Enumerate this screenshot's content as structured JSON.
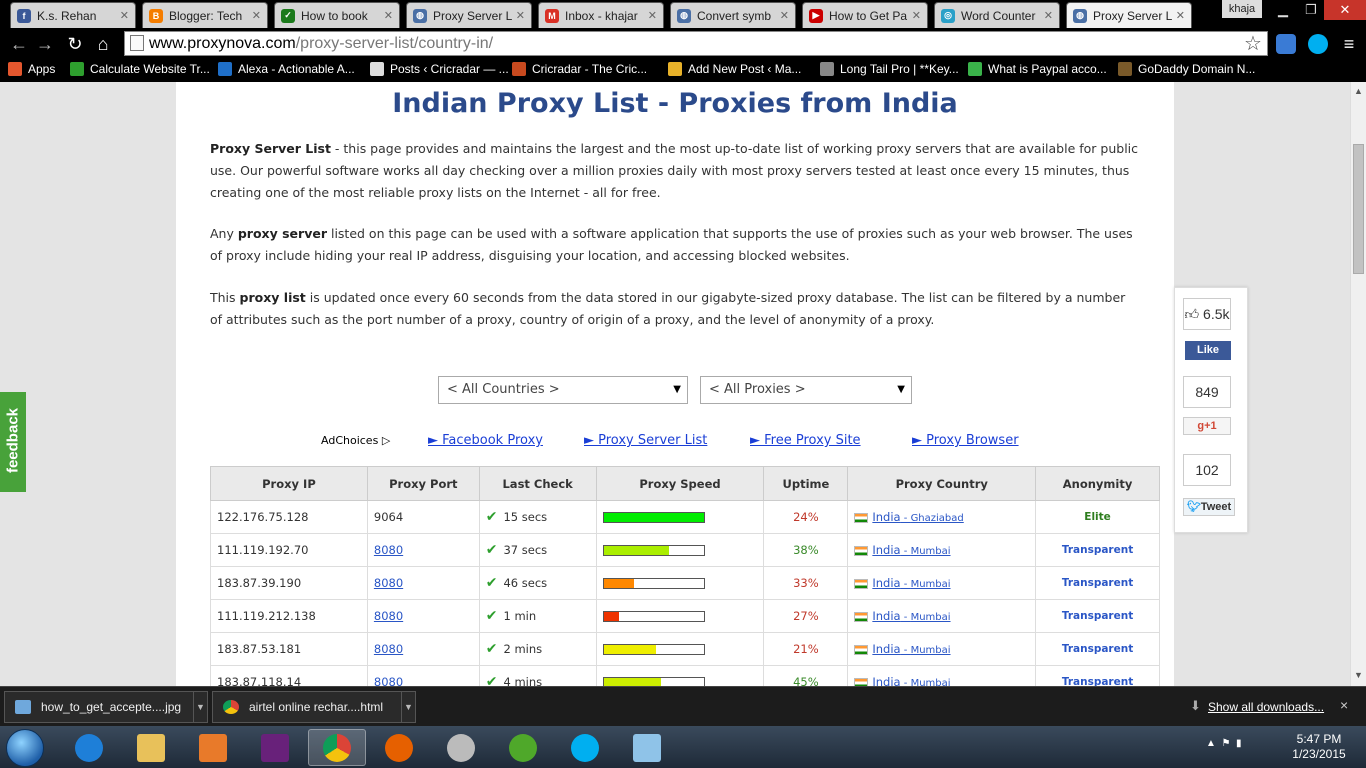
{
  "browser": {
    "tabs": [
      {
        "title": "K.s. Rehan",
        "icon": "facebook-icon",
        "color": "#3b5998",
        "glyph": "f"
      },
      {
        "title": "Blogger: Tech",
        "icon": "blogger-icon",
        "color": "#f57d00",
        "glyph": "B"
      },
      {
        "title": "How to book",
        "icon": "checkmark-favicon",
        "color": "#1b7a1b",
        "glyph": "✓"
      },
      {
        "title": "Proxy Server L",
        "icon": "globe-icon",
        "color": "#4a6fa5",
        "glyph": "◍"
      },
      {
        "title": "Inbox - khajar",
        "icon": "gmail-icon",
        "color": "#d93025",
        "glyph": "M"
      },
      {
        "title": "Convert symb",
        "icon": "globe-icon",
        "color": "#4a6fa5",
        "glyph": "◍"
      },
      {
        "title": "How to Get Pa",
        "icon": "youtube-icon",
        "color": "#cc0000",
        "glyph": "▶"
      },
      {
        "title": "Word Counter",
        "icon": "wordcounter-icon",
        "color": "#2aa0c8",
        "glyph": "◎"
      },
      {
        "title": "Proxy Server L",
        "icon": "globe-icon",
        "color": "#4a6fa5",
        "glyph": "◍"
      }
    ],
    "user_badge": "khaja",
    "address": {
      "host": "www.proxynova.com",
      "path": "/proxy-server-list/country-in/"
    },
    "bookmarks": [
      {
        "label": "Apps",
        "icon": "apps-grid-icon",
        "color": "#e4572e"
      },
      {
        "label": "Calculate Website Tr...",
        "icon": "dollar-icon",
        "color": "#2e9f2e"
      },
      {
        "label": "Alexa - Actionable A...",
        "icon": "alexa-icon",
        "color": "#1f6fc8"
      },
      {
        "label": "Posts ‹ Cricradar — ...",
        "icon": "document-icon",
        "color": "#dddddd"
      },
      {
        "label": "Cricradar - The Cric...",
        "icon": "cricradar-icon",
        "color": "#c84a1f"
      },
      {
        "label": "Add New Post ‹ Ma...",
        "icon": "people-icon",
        "color": "#e8b22a"
      },
      {
        "label": "Long Tail Pro | **Key...",
        "icon": "g-icon",
        "color": "#888888"
      },
      {
        "label": "What is Paypal acco...",
        "icon": "star-icon",
        "color": "#3ab34a"
      },
      {
        "label": "GoDaddy Domain N...",
        "icon": "godaddy-icon",
        "color": "#7a5a2a"
      }
    ]
  },
  "page": {
    "title": "Indian Proxy List - Proxies from India",
    "paragraphs": {
      "p1_bold": "Proxy Server List",
      "p1_rest": " - this page provides and maintains the largest and the most up-to-date list of working proxy servers that are available for public use. Our powerful software works all day checking over a million proxies daily with most proxy servers tested at least once every 15 minutes, thus creating one of the most reliable proxy lists on the Internet - all for free.",
      "p2_a": "Any ",
      "p2_bold": "proxy server",
      "p2_rest": " listed on this page can be used with a software application that supports the use of proxies such as your web browser. The uses of proxy include hiding your real IP address, disguising your location, and accessing blocked websites.",
      "p3_a": "This ",
      "p3_bold": "proxy list",
      "p3_rest": " is updated once every 60 seconds from the data stored in our gigabyte-sized proxy database. The list can be filtered by a number of attributes such as the port number of a proxy, country of origin of a proxy, and the level of anonymity of a proxy."
    },
    "filters": {
      "countries": "< All Countries >",
      "proxies": "< All Proxies >"
    },
    "adchoices": "AdChoices",
    "ad_links": [
      "► Facebook Proxy",
      "► Proxy Server List",
      "► Free Proxy Site",
      "► Proxy Browser"
    ],
    "table": {
      "headers": [
        "Proxy IP",
        "Proxy Port",
        "Last Check",
        "Proxy Speed",
        "Uptime",
        "Proxy Country",
        "Anonymity"
      ],
      "rows": [
        {
          "ip": "122.176.75.128",
          "port": "9064",
          "port_link": false,
          "check": "15 secs",
          "speed": 1.0,
          "speed_color": "#00ee00",
          "uptime": "24%",
          "country": "India",
          "city": "Ghaziabad",
          "anonymity": "Elite"
        },
        {
          "ip": "111.119.192.70",
          "port": "8080",
          "port_link": true,
          "check": "37 secs",
          "speed": 0.65,
          "speed_color": "#aaee00",
          "uptime": "38%",
          "country": "India",
          "city": "Mumbai",
          "anonymity": "Transparent"
        },
        {
          "ip": "183.87.39.190",
          "port": "8080",
          "port_link": true,
          "check": "46 secs",
          "speed": 0.3,
          "speed_color": "#ff8800",
          "uptime": "33%",
          "country": "India",
          "city": "Mumbai",
          "anonymity": "Transparent"
        },
        {
          "ip": "111.119.212.138",
          "port": "8080",
          "port_link": true,
          "check": "1 min",
          "speed": 0.15,
          "speed_color": "#ee3300",
          "uptime": "27%",
          "country": "India",
          "city": "Mumbai",
          "anonymity": "Transparent"
        },
        {
          "ip": "183.87.53.181",
          "port": "8080",
          "port_link": true,
          "check": "2 mins",
          "speed": 0.52,
          "speed_color": "#eeee00",
          "uptime": "21%",
          "country": "India",
          "city": "Mumbai",
          "anonymity": "Transparent"
        },
        {
          "ip": "183.87.118.14",
          "port": "8080",
          "port_link": true,
          "check": "4 mins",
          "speed": 0.57,
          "speed_color": "#ccee00",
          "uptime": "45%",
          "country": "India",
          "city": "Mumbai",
          "anonymity": "Transparent"
        }
      ]
    },
    "social": {
      "likes": "6.5k",
      "like_label": "Like",
      "plusones": "849",
      "plus_label": "+1",
      "tweets": "102",
      "tweet_label": "Tweet"
    },
    "feedback": "feedback"
  },
  "downloads": {
    "items": [
      {
        "name": "how_to_get_accepte....jpg",
        "icon": "image-file-icon"
      },
      {
        "name": "airtel online rechar....html",
        "icon": "chrome-file-icon"
      }
    ],
    "show_all": "Show all downloads...",
    "close": "×"
  },
  "taskbar": {
    "apps": [
      "internet-explorer-icon",
      "file-explorer-icon",
      "media-player-icon",
      "visual-studio-icon",
      "chrome-icon",
      "firefox-icon",
      "satellite-icon",
      "utorrent-icon",
      "skype-icon",
      "notepad-icon"
    ],
    "time": "5:47 PM",
    "date": "1/23/2015"
  }
}
